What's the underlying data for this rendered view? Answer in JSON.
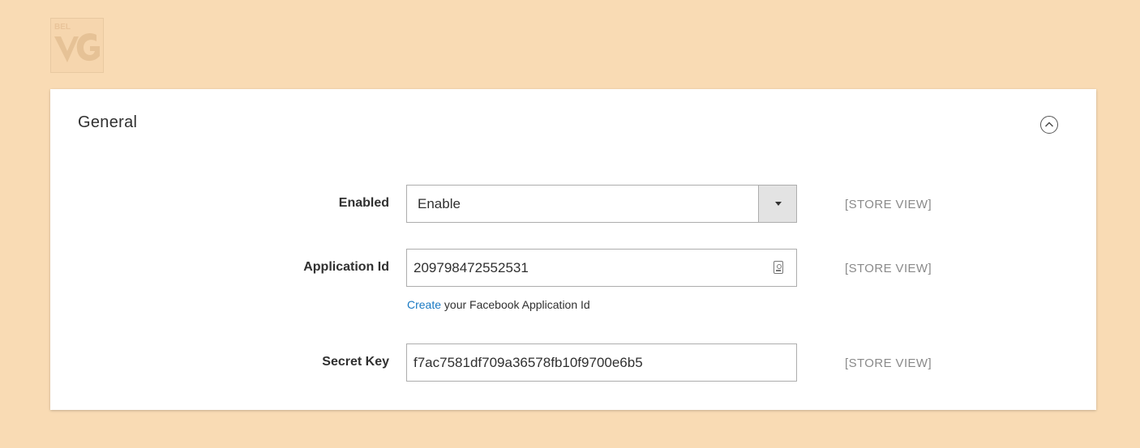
{
  "panel": {
    "title": "General",
    "collapse_icon": "chevron-up-circle-icon"
  },
  "fields": {
    "enabled": {
      "label": "Enabled",
      "value": "Enable",
      "scope": "[STORE VIEW]"
    },
    "application_id": {
      "label": "Application Id",
      "value": "209798472552531",
      "scope": "[STORE VIEW]",
      "note_link": "Create",
      "note_text": " your Facebook Application Id",
      "icon": "key-icon"
    },
    "secret_key": {
      "label": "Secret Key",
      "value": "f7ac7581df709a36578fb10f9700e6b5",
      "scope": "[STORE VIEW]"
    }
  },
  "colors": {
    "background": "#f9dbb4",
    "panel": "#ffffff",
    "link": "#1979c3",
    "scope_text": "#8a8a8a"
  }
}
